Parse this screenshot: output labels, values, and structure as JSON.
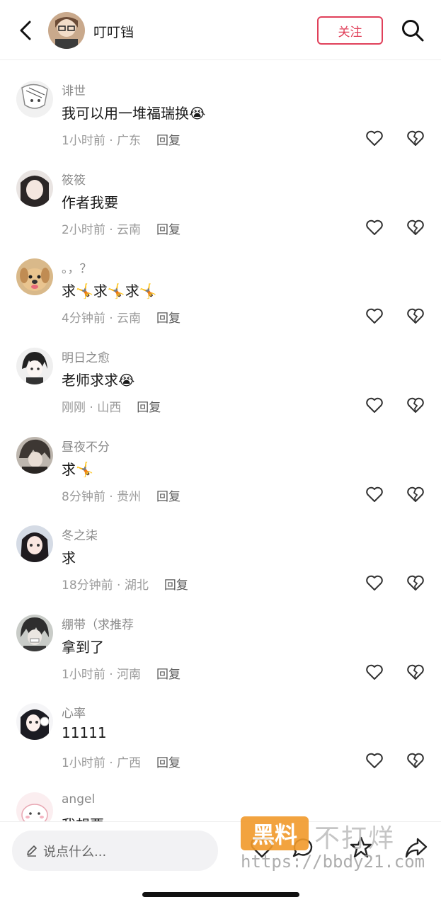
{
  "header": {
    "title": "叮叮铛",
    "follow_label": "关注"
  },
  "comments": [
    {
      "name": "诽世",
      "text": "我可以用一堆福瑞换",
      "emoji": "😭",
      "meta": "1小时前 · 广东",
      "reply": "回复"
    },
    {
      "name": "筱筱",
      "text": "作者我要",
      "emoji": "",
      "meta": "2小时前 · 云南",
      "reply": "回复"
    },
    {
      "name": "。，？",
      "text": "求🤸求🤸求🤸",
      "emoji": "",
      "meta": "4分钟前 · 云南",
      "reply": "回复"
    },
    {
      "name": "明日之愈",
      "text": "老师求求",
      "emoji": "😭",
      "meta": "刚刚 · 山西",
      "reply": "回复"
    },
    {
      "name": "昼夜不分",
      "text": "求🤸",
      "emoji": "",
      "meta": "8分钟前 · 贵州",
      "reply": "回复"
    },
    {
      "name": "冬之柒",
      "text": "求",
      "emoji": "",
      "meta": "18分钟前 · 湖北",
      "reply": "回复"
    },
    {
      "name": "绷带（求推荐",
      "text": "拿到了",
      "emoji": "",
      "meta": "1小时前 · 河南",
      "reply": "回复"
    },
    {
      "name": "心率",
      "text": "11111",
      "emoji": "",
      "meta": "1小时前 · 广西",
      "reply": "回复"
    },
    {
      "name": "angel",
      "text": "我想要",
      "emoji": "",
      "meta": "",
      "reply": ""
    }
  ],
  "bottom": {
    "input_placeholder": "说点什么...",
    "watermark_badge": "黑料",
    "watermark_brand": "不打烊",
    "watermark_url": "https://bbdy21.com"
  },
  "colors": {
    "accent": "#e0405a",
    "watermark": "#f19a2b"
  },
  "icons": [
    "back-arrow-icon",
    "search-icon",
    "heart-icon",
    "broken-heart-icon",
    "pen-icon",
    "star-icon",
    "share-icon"
  ]
}
